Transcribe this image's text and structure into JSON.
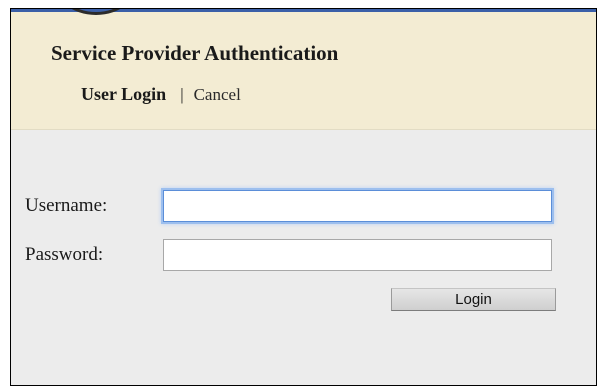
{
  "header": {
    "title": "Service Provider Authentication",
    "nav": {
      "user_login": "User Login",
      "separator": "|",
      "cancel": "Cancel"
    }
  },
  "form": {
    "username_label": "Username:",
    "username_value": "",
    "password_label": "Password:",
    "password_value": "",
    "login_button": "Login"
  },
  "colors": {
    "header_background": "#f3ecd3",
    "content_background": "#ececec",
    "focus_ring": "#9dbfee",
    "top_strip": "#3a5fa8"
  }
}
